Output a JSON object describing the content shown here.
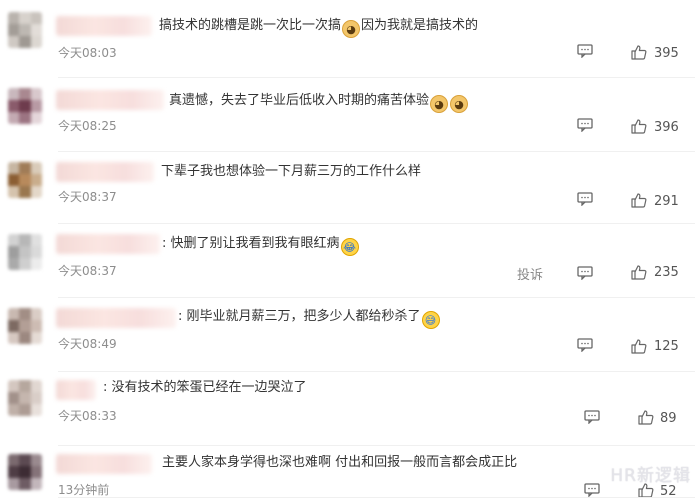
{
  "comments": [
    {
      "text_a": "搞技术的跳槽是跳一次比一次搞",
      "text_b": "因为我就是搞技术的",
      "time": "今天08:03",
      "likes": "395",
      "emojis": [
        "doge"
      ]
    },
    {
      "text_a": "真遗憾，失去了毕业后低收入时期的痛苦体验",
      "time": "今天08:25",
      "likes": "396",
      "emojis": [
        "doge",
        "doge"
      ]
    },
    {
      "text_a": "下辈子我也想体验一下月薪三万的工作什么样",
      "time": "今天08:37",
      "likes": "291"
    },
    {
      "text_a": "快删了别让我看到我有眼红病",
      "time": "今天08:37",
      "likes": "235",
      "report": "投诉",
      "emojis": [
        "laugh"
      ]
    },
    {
      "text_a": "刚毕业就月薪三万，把多少人都给秒杀了",
      "time": "今天08:49",
      "likes": "125",
      "emojis": [
        "sweat"
      ]
    },
    {
      "text_a": "没有技术的笨蛋已经在一边哭泣了",
      "time": "今天08:33",
      "likes": "89"
    },
    {
      "text_a": "主要人家本身学得也深也难啊 付出和回报一般而言都会成正比",
      "time": "13分钟前",
      "likes": "52"
    }
  ],
  "icons": {
    "reply": "comment-bubble-icon",
    "like": "thumbs-up-icon"
  },
  "watermark": "HR新逻辑"
}
